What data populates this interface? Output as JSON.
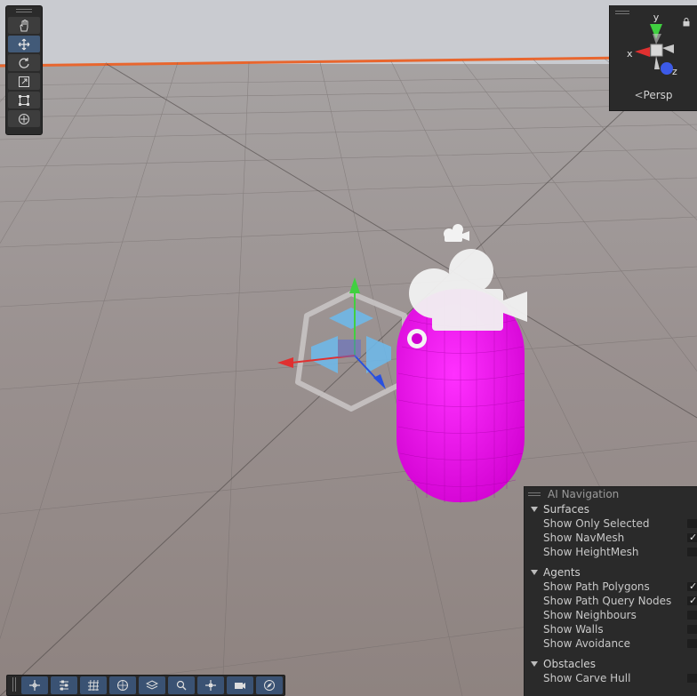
{
  "toolbar": {
    "tools": [
      {
        "name": "hand-tool",
        "icon": "hand-icon",
        "active": false
      },
      {
        "name": "move-tool",
        "icon": "move-icon",
        "active": true
      },
      {
        "name": "rotate-tool",
        "icon": "rotate-icon",
        "active": false
      },
      {
        "name": "scale-tool",
        "icon": "scale-icon",
        "active": false
      },
      {
        "name": "rect-tool",
        "icon": "rect-transform-icon",
        "active": false
      },
      {
        "name": "transform-tool",
        "icon": "transform-icon",
        "active": false
      }
    ]
  },
  "orientation_gizmo": {
    "y_label": "y",
    "x_label": "x",
    "z_label": "z",
    "projection_label": "Persp",
    "lock_icon": "lock-icon"
  },
  "ai_navigation": {
    "title": "AI Navigation",
    "sections": [
      {
        "label": "Surfaces",
        "items": [
          {
            "label": "Show Only Selected",
            "checked": false
          },
          {
            "label": "Show NavMesh",
            "checked": true
          },
          {
            "label": "Show HeightMesh",
            "checked": false
          }
        ]
      },
      {
        "label": "Agents",
        "items": [
          {
            "label": "Show Path Polygons",
            "checked": true
          },
          {
            "label": "Show Path Query Nodes",
            "checked": true
          },
          {
            "label": "Show Neighbours",
            "checked": false
          },
          {
            "label": "Show Walls",
            "checked": false
          },
          {
            "label": "Show Avoidance",
            "checked": false
          }
        ]
      },
      {
        "label": "Obstacles",
        "items": [
          {
            "label": "Show Carve Hull",
            "checked": false
          }
        ]
      }
    ]
  },
  "colors": {
    "capsule": "#e000e0",
    "horizon_line": "#e8662e",
    "sky": "#c9cbd0",
    "ground": "#8e8582",
    "x_axis": "#e03030",
    "y_axis": "#40d040",
    "z_axis": "#2850e0"
  },
  "bottom_overlays": [
    {
      "icon": "move-gizmo-icon"
    },
    {
      "icon": "sliders-icon"
    },
    {
      "icon": "grid-icon"
    },
    {
      "icon": "sphere-icon"
    },
    {
      "icon": "layers-icon"
    },
    {
      "icon": "search-icon"
    },
    {
      "icon": "pivot-icon"
    },
    {
      "icon": "camera-icon"
    },
    {
      "icon": "compass-icon"
    }
  ]
}
